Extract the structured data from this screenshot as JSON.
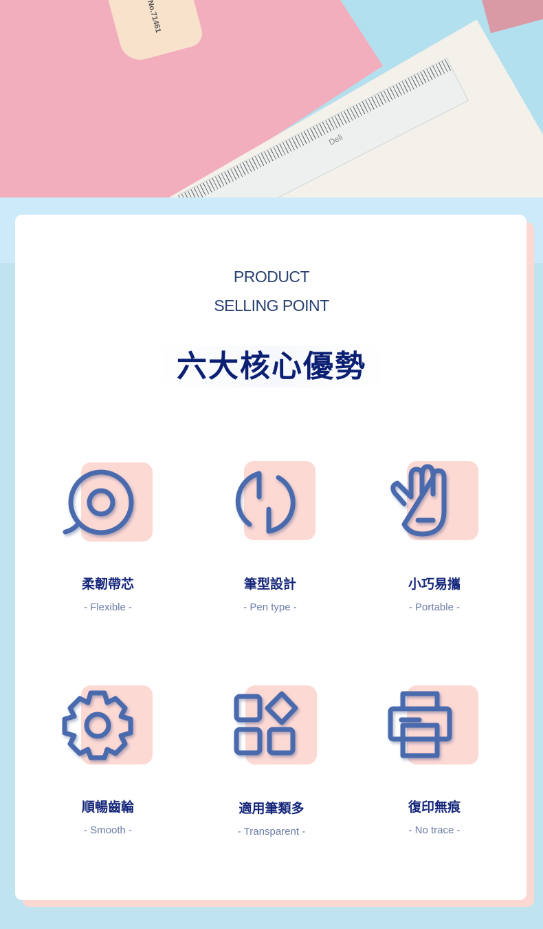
{
  "photo": {
    "product_label": "No.71461",
    "ruler_brand": "Deli"
  },
  "heading": {
    "line1": "PRODUCT",
    "line2": "SELLING POINT",
    "title": "六大核心優勢"
  },
  "features": [
    {
      "title": "柔韌帶芯",
      "subtitle": "- Flexible -",
      "icon": "tape-roll-icon"
    },
    {
      "title": "筆型設計",
      "subtitle": "- Pen type -",
      "icon": "refresh-cycle-icon"
    },
    {
      "title": "小巧易攜",
      "subtitle": "- Portable -",
      "icon": "hand-icon"
    },
    {
      "title": "順暢齒輪",
      "subtitle": "- Smooth -",
      "icon": "gear-icon"
    },
    {
      "title": "適用筆類多",
      "subtitle": "- Transparent -",
      "icon": "grid-apps-icon"
    },
    {
      "title": "復印無痕",
      "subtitle": "- No trace -",
      "icon": "printer-icon"
    }
  ],
  "colors": {
    "accent": "#4a6aae",
    "tile": "#fdd9d4",
    "title": "#0b1f73"
  }
}
